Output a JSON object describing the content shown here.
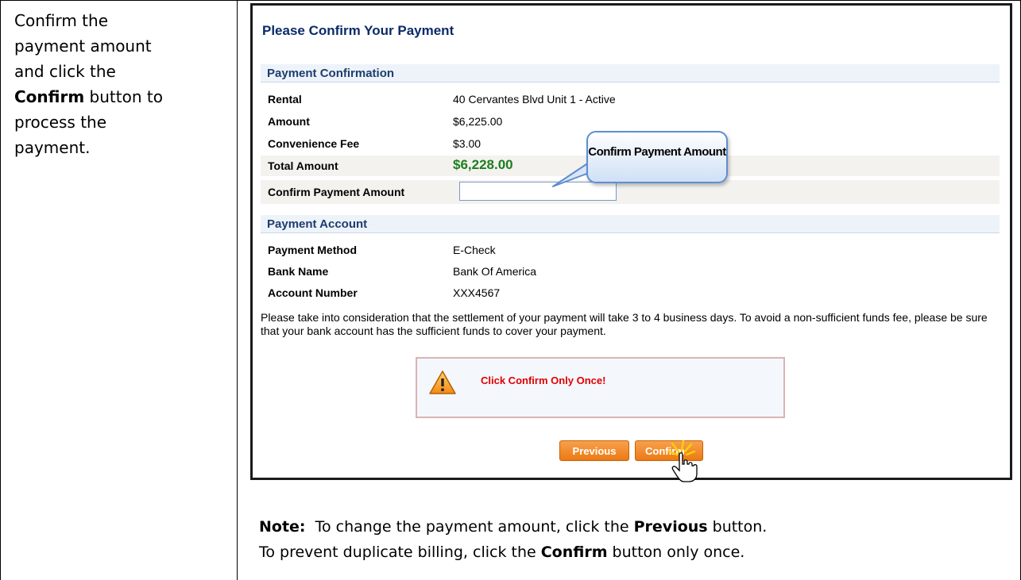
{
  "instruction": {
    "line1": "Confirm the",
    "line2": "payment amount",
    "line3": "and click the",
    "line4_bold": "Confirm",
    "line4_rest": " button to",
    "line5": "process the",
    "line6": "payment."
  },
  "screen": {
    "title": "Please Confirm Your Payment",
    "payment_confirmation": {
      "heading": "Payment Confirmation",
      "rows": [
        {
          "label": "Rental",
          "value": "40 Cervantes Blvd Unit 1 - Active"
        },
        {
          "label": "Amount",
          "value": "$6,225.00"
        },
        {
          "label": "Convenience Fee",
          "value": "$3.00"
        },
        {
          "label": "Total Amount",
          "value": "$6,228.00"
        }
      ],
      "confirm_amount_label": "Confirm Payment Amount",
      "confirm_amount_value": ""
    },
    "payment_account": {
      "heading": "Payment Account",
      "rows": [
        {
          "label": "Payment Method",
          "value": "E-Check"
        },
        {
          "label": "Bank Name",
          "value": "Bank Of America"
        },
        {
          "label": "Account Number",
          "value": "XXX4567"
        }
      ]
    },
    "notice": "Please take into consideration that the settlement of your payment will take 3 to 4 business days. To avoid a non-sufficient funds fee, please be sure that your bank account has the sufficient funds to cover your payment.",
    "warning": "Click Confirm Only Once!",
    "buttons": {
      "previous": "Previous",
      "confirm": "Confirm"
    },
    "callout": "Confirm Payment Amount",
    "colors": {
      "title": "#0b2a6a",
      "total": "#1e7d1e",
      "warning": "#e00000",
      "button": "#ec7a14"
    }
  },
  "note": {
    "label": "Note:",
    "line1_pre": "  To change the payment amount, click the ",
    "line1_bold": "Previous",
    "line1_post": " button.",
    "line2_pre": "To prevent duplicate billing, click the ",
    "line2_bold": "Confirm",
    "line2_post": " button only once."
  }
}
